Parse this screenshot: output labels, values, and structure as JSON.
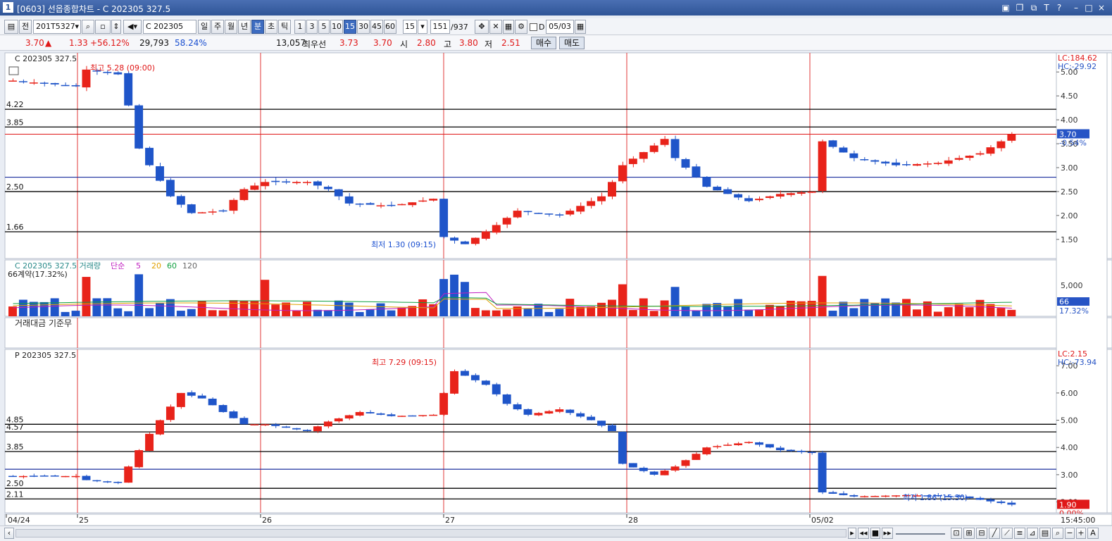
{
  "window": {
    "number": "1",
    "title": "[0603] 선옵종합차트 - C 202305 327.5"
  },
  "toolbar": {
    "period": "전",
    "code": "201T5327",
    "option_code": "C 202305 327",
    "tf": [
      "일",
      "주",
      "월",
      "년",
      "분",
      "초",
      "틱"
    ],
    "selected_tf": "분",
    "intervals": [
      "1",
      "3",
      "5",
      "10",
      "15",
      "30",
      "45",
      "60"
    ],
    "selected_interval": "15",
    "interval_value": "15",
    "count": "151",
    "total": "/937",
    "d_label": "D",
    "date": "05/03"
  },
  "quote": {
    "price": "3.70",
    "arrow": "▲",
    "change": "1.33",
    "rate": "+56.12%",
    "volume": "29,793",
    "vol_rate": "58.24%",
    "sum_vol": "13,057",
    "best_label": "최우선",
    "ask": "3.73",
    "bid": "3.70",
    "open_label": "시",
    "open": "2.80",
    "high_label": "고",
    "high": "3.80",
    "low_label": "저",
    "low": "2.51",
    "buy": "매수",
    "sell": "매도"
  },
  "panel1": {
    "label": "C 202305 327.5",
    "high_annot": "최고 5.28 (09:00)",
    "low_annot": "최저 1.30 (09:15)",
    "lc": "LC:184.62",
    "hc": "HC:-29.92",
    "price_tag": "3.70",
    "pct_tag": "-0.54%",
    "levels": [
      {
        "label": "4.22",
        "v": 4.22
      },
      {
        "label": "3.85",
        "v": 3.85
      },
      {
        "label": "2.50",
        "v": 2.5
      },
      {
        "label": "1.66",
        "v": 1.66
      }
    ],
    "yticks": [
      "5.00",
      "4.50",
      "4.00",
      "3.50",
      "3.00",
      "2.50",
      "2.00",
      "1.50"
    ]
  },
  "panel2": {
    "label": "C 202305 327.5 거래량",
    "ma_label": "단순",
    "ma": [
      "5",
      "20",
      "60",
      "120"
    ],
    "sub": "66계약(17.32%)",
    "tick": "5,000",
    "tag": "66",
    "tag2": "17.32%"
  },
  "panel3": {
    "label": "거래대금 기준무"
  },
  "panel4": {
    "label": "P 202305 327.5",
    "high_annot": "최고 7.29 (09:15)",
    "low_annot": "최저 1.86 (15:30)",
    "lc": "LC:2.15",
    "hc": "HC:-73.94",
    "price_tag": "1.90",
    "pct_tag": "0.00%",
    "levels": [
      {
        "label": "4.85",
        "v": 4.85
      },
      {
        "label": "4.57",
        "v": 4.57
      },
      {
        "label": "3.85",
        "v": 3.85
      },
      {
        "label": "2.50",
        "v": 2.5
      },
      {
        "label": "2.11",
        "v": 2.11
      }
    ],
    "yticks": [
      "7.00",
      "6.00",
      "5.00",
      "4.00",
      "3.00",
      "2.00"
    ]
  },
  "xaxis": {
    "labels": [
      "04/24",
      "25",
      "26",
      "27",
      "28",
      "05/02"
    ],
    "time": "15:45:00"
  },
  "colors": {
    "up": "#e8231a",
    "down": "#1f55c9",
    "bg": "#ffffff",
    "grid": "#d0d6e0"
  }
}
